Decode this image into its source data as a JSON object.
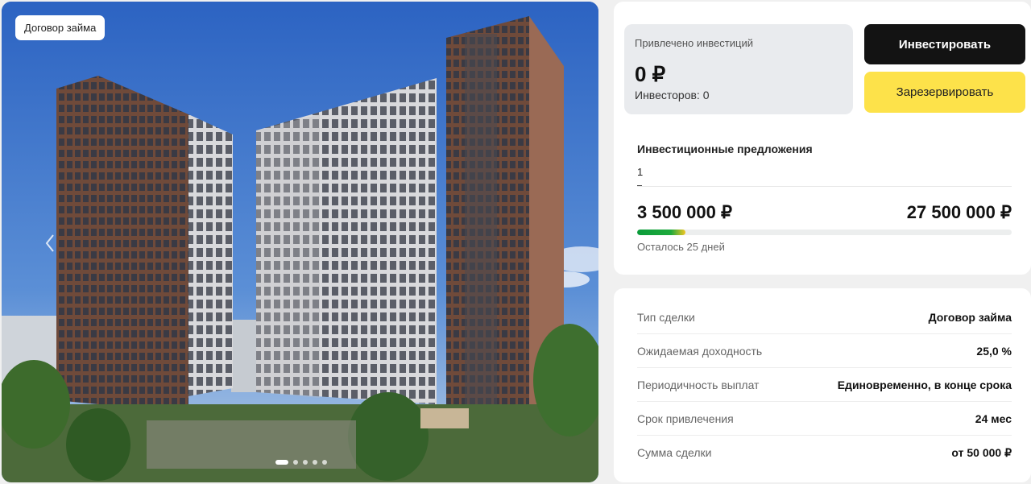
{
  "photo": {
    "badge": "Договор займа",
    "slides_total": 5,
    "active_slide": 1
  },
  "investment": {
    "raised_label": "Привлечено инвестиций",
    "raised_amount": "0 ₽",
    "investors_text": "Инвесторов: 0",
    "invest_button": "Инвестировать",
    "reserve_button": "Зарезервировать",
    "offers_title": "Инвестиционные предложения",
    "offers_count": "1",
    "min_amount": "3 500 000 ₽",
    "max_amount": "27 500 000 ₽",
    "progress_fraction": 0.13,
    "remaining_text": "Осталось 25 дней"
  },
  "details": [
    {
      "key": "Тип сделки",
      "value": "Договор займа"
    },
    {
      "key": "Ожидаемая доходность",
      "value": "25,0 %"
    },
    {
      "key": "Периодичность выплат",
      "value": "Единовременно, в конце срока"
    },
    {
      "key": "Срок привлечения",
      "value": "24 мес"
    },
    {
      "key": "Сумма сделки",
      "value": "от 50 000 ₽"
    }
  ],
  "colors": {
    "primary_button": "#131313",
    "reserve_button": "#fde24a",
    "progress_green": "#0a9b3a",
    "progress_yellow": "#f2c623"
  }
}
